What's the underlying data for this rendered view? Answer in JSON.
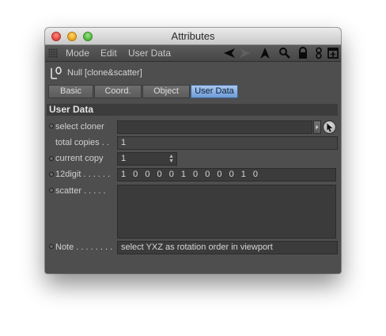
{
  "window": {
    "title": "Attributes"
  },
  "menubar": {
    "items": [
      "Mode",
      "Edit",
      "User Data"
    ],
    "tools": [
      "back-arrow-icon",
      "forward-arrow-icon",
      "up-arrow-icon",
      "search-icon",
      "lock-icon",
      "link-icon",
      "new-panel-icon"
    ]
  },
  "object": {
    "icon": "null-object-icon",
    "name": "Null [clone&scatter]"
  },
  "tabs": [
    {
      "label": "Basic",
      "active": false
    },
    {
      "label": "Coord.",
      "active": false
    },
    {
      "label": "Object",
      "active": false
    },
    {
      "label": "User Data",
      "active": true
    }
  ],
  "section": {
    "title": "User Data"
  },
  "fields": {
    "select_cloner": {
      "label": "select cloner",
      "value": ""
    },
    "total_copies": {
      "label": "total copies . .",
      "value": "1"
    },
    "current_copy": {
      "label": "current copy",
      "value": "1"
    },
    "twelve_digit": {
      "label": "12digit . . . . . .",
      "value": "1 0 0 0 0 1 0 0 0 0 1 0"
    },
    "scatter": {
      "label": "scatter . . . . .",
      "value": ""
    },
    "note": {
      "label": "Note . . . . . . . .",
      "value": "select YXZ as rotation order in viewport"
    }
  },
  "colors": {
    "panel_bg": "#4e4e4e",
    "active_tab": "#88addf",
    "field_bg": "#3b3b3b"
  }
}
